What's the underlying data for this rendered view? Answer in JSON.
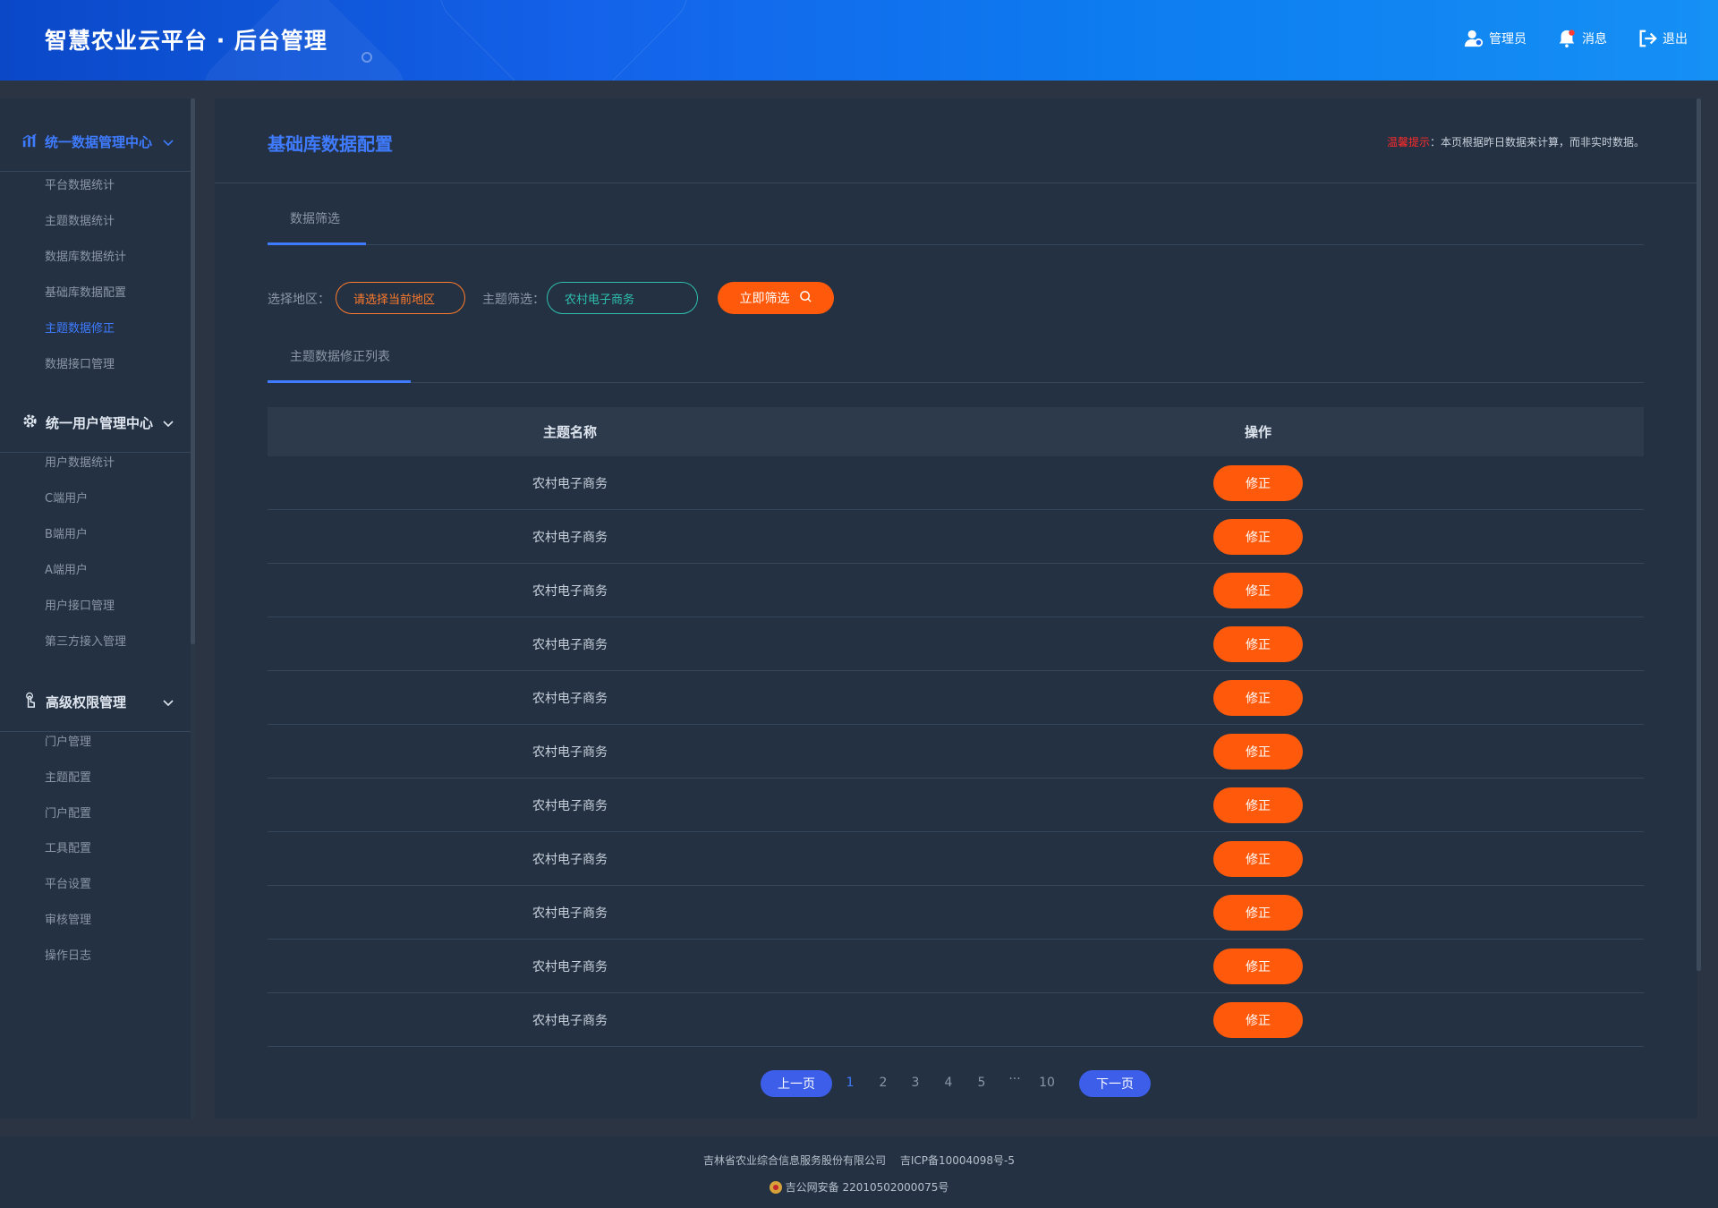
{
  "header": {
    "title": "智慧农业云平台 · 后台管理",
    "actions": [
      {
        "label": "管理员",
        "icon": "admin-user-icon"
      },
      {
        "label": "消息",
        "icon": "bell-icon"
      },
      {
        "label": "退出",
        "icon": "logout-icon"
      }
    ]
  },
  "sidebar": {
    "groups": [
      {
        "label": "统一数据管理中心",
        "icon": "bar-chart-icon",
        "active": true,
        "items": [
          "平台数据统计",
          "主题数据统计",
          "数据库数据统计",
          "基础库数据配置",
          "主题数据修正",
          "数据接口管理"
        ],
        "active_item": "主题数据修正"
      },
      {
        "label": "统一用户管理中心",
        "icon": "gear-icon",
        "items": [
          "用户数据统计",
          "C端用户",
          "B端用户",
          "A端用户",
          "用户接口管理",
          "第三方接入管理"
        ]
      },
      {
        "label": "高级权限管理",
        "icon": "touch-hand-icon",
        "items": [
          "门户管理",
          "主题配置",
          "门户配置",
          "工具配置",
          "平台设置",
          "审核管理",
          "操作日志"
        ]
      }
    ]
  },
  "main": {
    "title": "基础库数据配置",
    "tip_label": "温馨提示",
    "tip_text": "：本页根据昨日数据来计算，而非实时数据。",
    "filter_tab": "数据筛选",
    "filter": {
      "region_label": "选择地区：",
      "region_value": "请选择当前地区",
      "topic_label": "主题筛选：",
      "topic_value": "农村电子商务",
      "submit_label": "立即筛选"
    },
    "list_tab": "主题数据修正列表",
    "table": {
      "columns": [
        "主题名称",
        "操作"
      ],
      "rows": [
        {
          "name": "农村电子商务",
          "action": "修正"
        },
        {
          "name": "农村电子商务",
          "action": "修正"
        },
        {
          "name": "农村电子商务",
          "action": "修正"
        },
        {
          "name": "农村电子商务",
          "action": "修正"
        },
        {
          "name": "农村电子商务",
          "action": "修正"
        },
        {
          "name": "农村电子商务",
          "action": "修正"
        },
        {
          "name": "农村电子商务",
          "action": "修正"
        },
        {
          "name": "农村电子商务",
          "action": "修正"
        },
        {
          "name": "农村电子商务",
          "action": "修正"
        },
        {
          "name": "农村电子商务",
          "action": "修正"
        },
        {
          "name": "农村电子商务",
          "action": "修正"
        }
      ]
    },
    "pagination": {
      "prev": "上一页",
      "pages": [
        "1",
        "2",
        "3",
        "4",
        "5",
        "···",
        "10"
      ],
      "current": "1",
      "next": "下一页"
    }
  },
  "footer": {
    "company": "吉林省农业综合信息服务股份有限公司",
    "icp": "吉ICP备10004098号-5",
    "police": "吉公网安备 22010502000075号"
  },
  "colors": {
    "accent": "#3f7bff",
    "action": "#ff5a0c",
    "teal": "#2fbfae",
    "warning": "#ff2a2a",
    "panel": "#233142",
    "background": "#2a3442"
  }
}
